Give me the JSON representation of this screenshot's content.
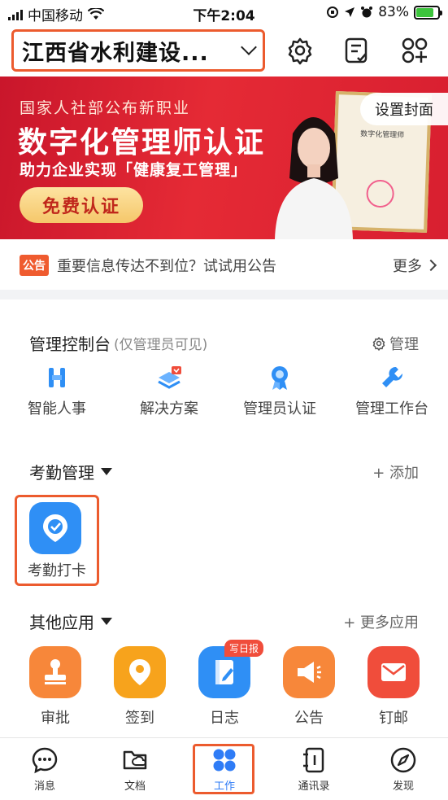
{
  "status_bar": {
    "carrier": "中国移动",
    "time": "下午2:04",
    "battery": "83%"
  },
  "header": {
    "org_name": "江西省水利建设..."
  },
  "banner": {
    "line1": "国家人社部公布新职业",
    "title": "数字化管理师认证",
    "subtitle": "助力企业实现「健康复工管理」",
    "button": "免费认证",
    "cover_button": "设置封面",
    "cert_title": "数字化管理师"
  },
  "notice": {
    "tag": "公告",
    "text": "重要信息传达不到位？试试用公告",
    "more": "更多"
  },
  "admin": {
    "title": "管理控制台",
    "note": "(仅管理员可见)",
    "action": "管理",
    "items": [
      {
        "label": "智能人事",
        "icon": "smart-hr-icon"
      },
      {
        "label": "解决方案",
        "icon": "solution-icon"
      },
      {
        "label": "管理员认证",
        "icon": "admin-cert-icon"
      },
      {
        "label": "管理工作台",
        "icon": "workbench-icon"
      }
    ]
  },
  "attendance": {
    "title": "考勤管理",
    "action": "+ 添加",
    "app_label": "考勤打卡"
  },
  "other_apps": {
    "title": "其他应用",
    "action": "+ 更多应用",
    "apps": [
      {
        "label": "审批",
        "color": "#f7873a",
        "icon": "stamp-icon"
      },
      {
        "label": "签到",
        "color": "#f7a31c",
        "icon": "location-pin-icon"
      },
      {
        "label": "日志",
        "color": "#2f8ff5",
        "icon": "log-icon",
        "badge": "写日报"
      },
      {
        "label": "公告",
        "color": "#f7873a",
        "icon": "megaphone-icon"
      },
      {
        "label": "钉邮",
        "color": "#f04d3b",
        "icon": "mail-icon"
      }
    ]
  },
  "tabbar": {
    "tabs": [
      {
        "label": "消息",
        "icon": "chat-icon"
      },
      {
        "label": "文档",
        "icon": "folder-icon"
      },
      {
        "label": "工作",
        "icon": "grid-icon",
        "active": true
      },
      {
        "label": "通讯录",
        "icon": "contacts-icon"
      },
      {
        "label": "发现",
        "icon": "compass-icon"
      }
    ]
  },
  "colors": {
    "accent_blue": "#2f7cf6",
    "highlight": "#ec5b2e",
    "banner_red": "#d81f30"
  }
}
